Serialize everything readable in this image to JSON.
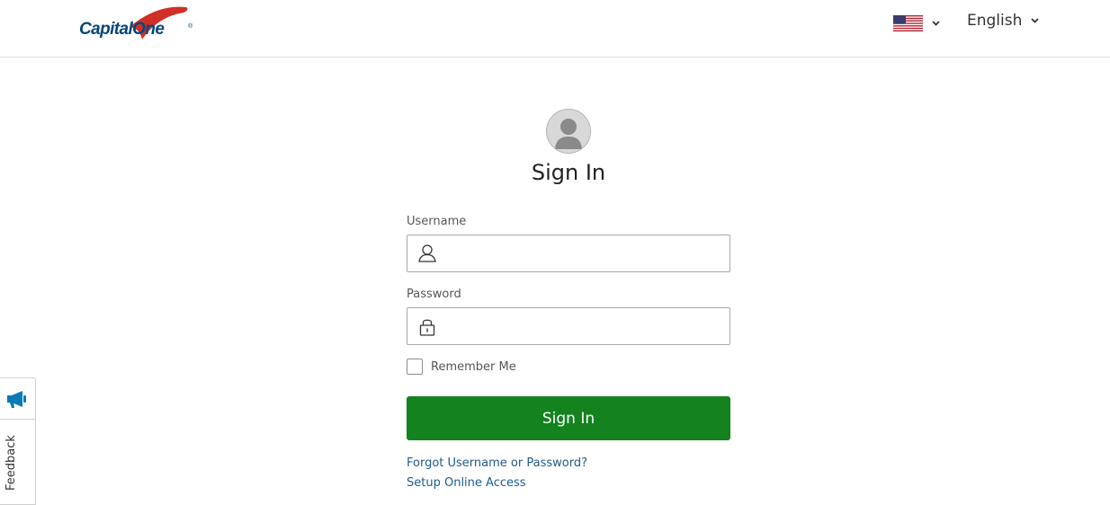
{
  "header": {
    "logo_text": "Capital One",
    "logo_text_a": "Capital",
    "logo_text_b": "One",
    "country": {
      "flag": "us-flag-icon"
    },
    "language": {
      "selected": "English"
    }
  },
  "colors": {
    "brand_blue": "#004879",
    "brand_red": "#d03027",
    "primary_button": "#13821f",
    "link": "#1e5a8c",
    "feedback_icon": "#0a7bb5"
  },
  "signin": {
    "title": "Sign In",
    "username_label": "Username",
    "username_value": "",
    "password_label": "Password",
    "password_value": "",
    "remember_label": "Remember Me",
    "button_label": "Sign In",
    "forgot_link": "Forgot Username or Password?",
    "setup_link": "Setup Online Access"
  },
  "feedback": {
    "label": "Feedback",
    "icon": "megaphone-icon"
  }
}
